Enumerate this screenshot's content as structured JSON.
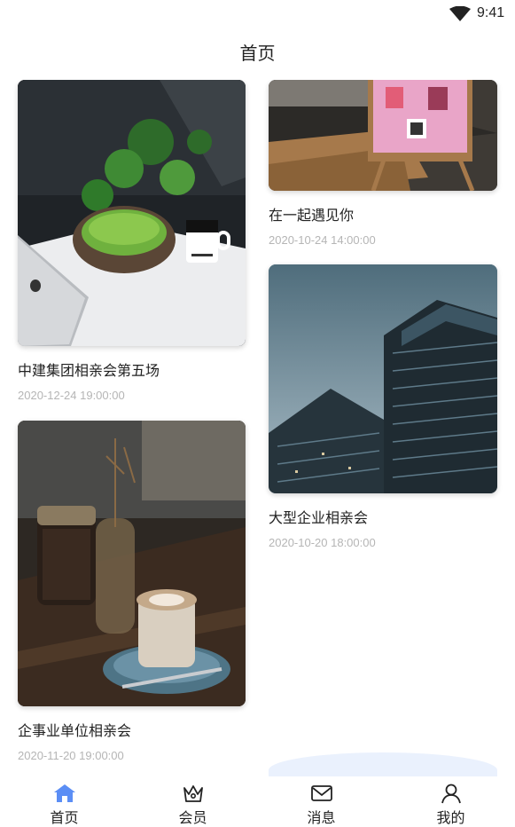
{
  "status_bar": {
    "time": "9:41"
  },
  "header": {
    "title": "首页"
  },
  "feed": {
    "left": [
      {
        "title": "中建集团相亲会第五场",
        "date": "2020-12-24 19:00:00"
      },
      {
        "title": "企事业单位相亲会",
        "date": "2020-11-20 19:00:00"
      }
    ],
    "right": [
      {
        "title": "在一起遇见你",
        "date": "2020-10-24 14:00:00"
      },
      {
        "title": "大型企业相亲会",
        "date": "2020-10-20 18:00:00"
      }
    ]
  },
  "tabbar": {
    "active": "home",
    "active_color": "#5b8ef5",
    "items": [
      {
        "label": "首页",
        "icon": "home-icon"
      },
      {
        "label": "会员",
        "icon": "crown-icon"
      },
      {
        "label": "消息",
        "icon": "mail-icon"
      },
      {
        "label": "我的",
        "icon": "user-icon"
      }
    ]
  }
}
